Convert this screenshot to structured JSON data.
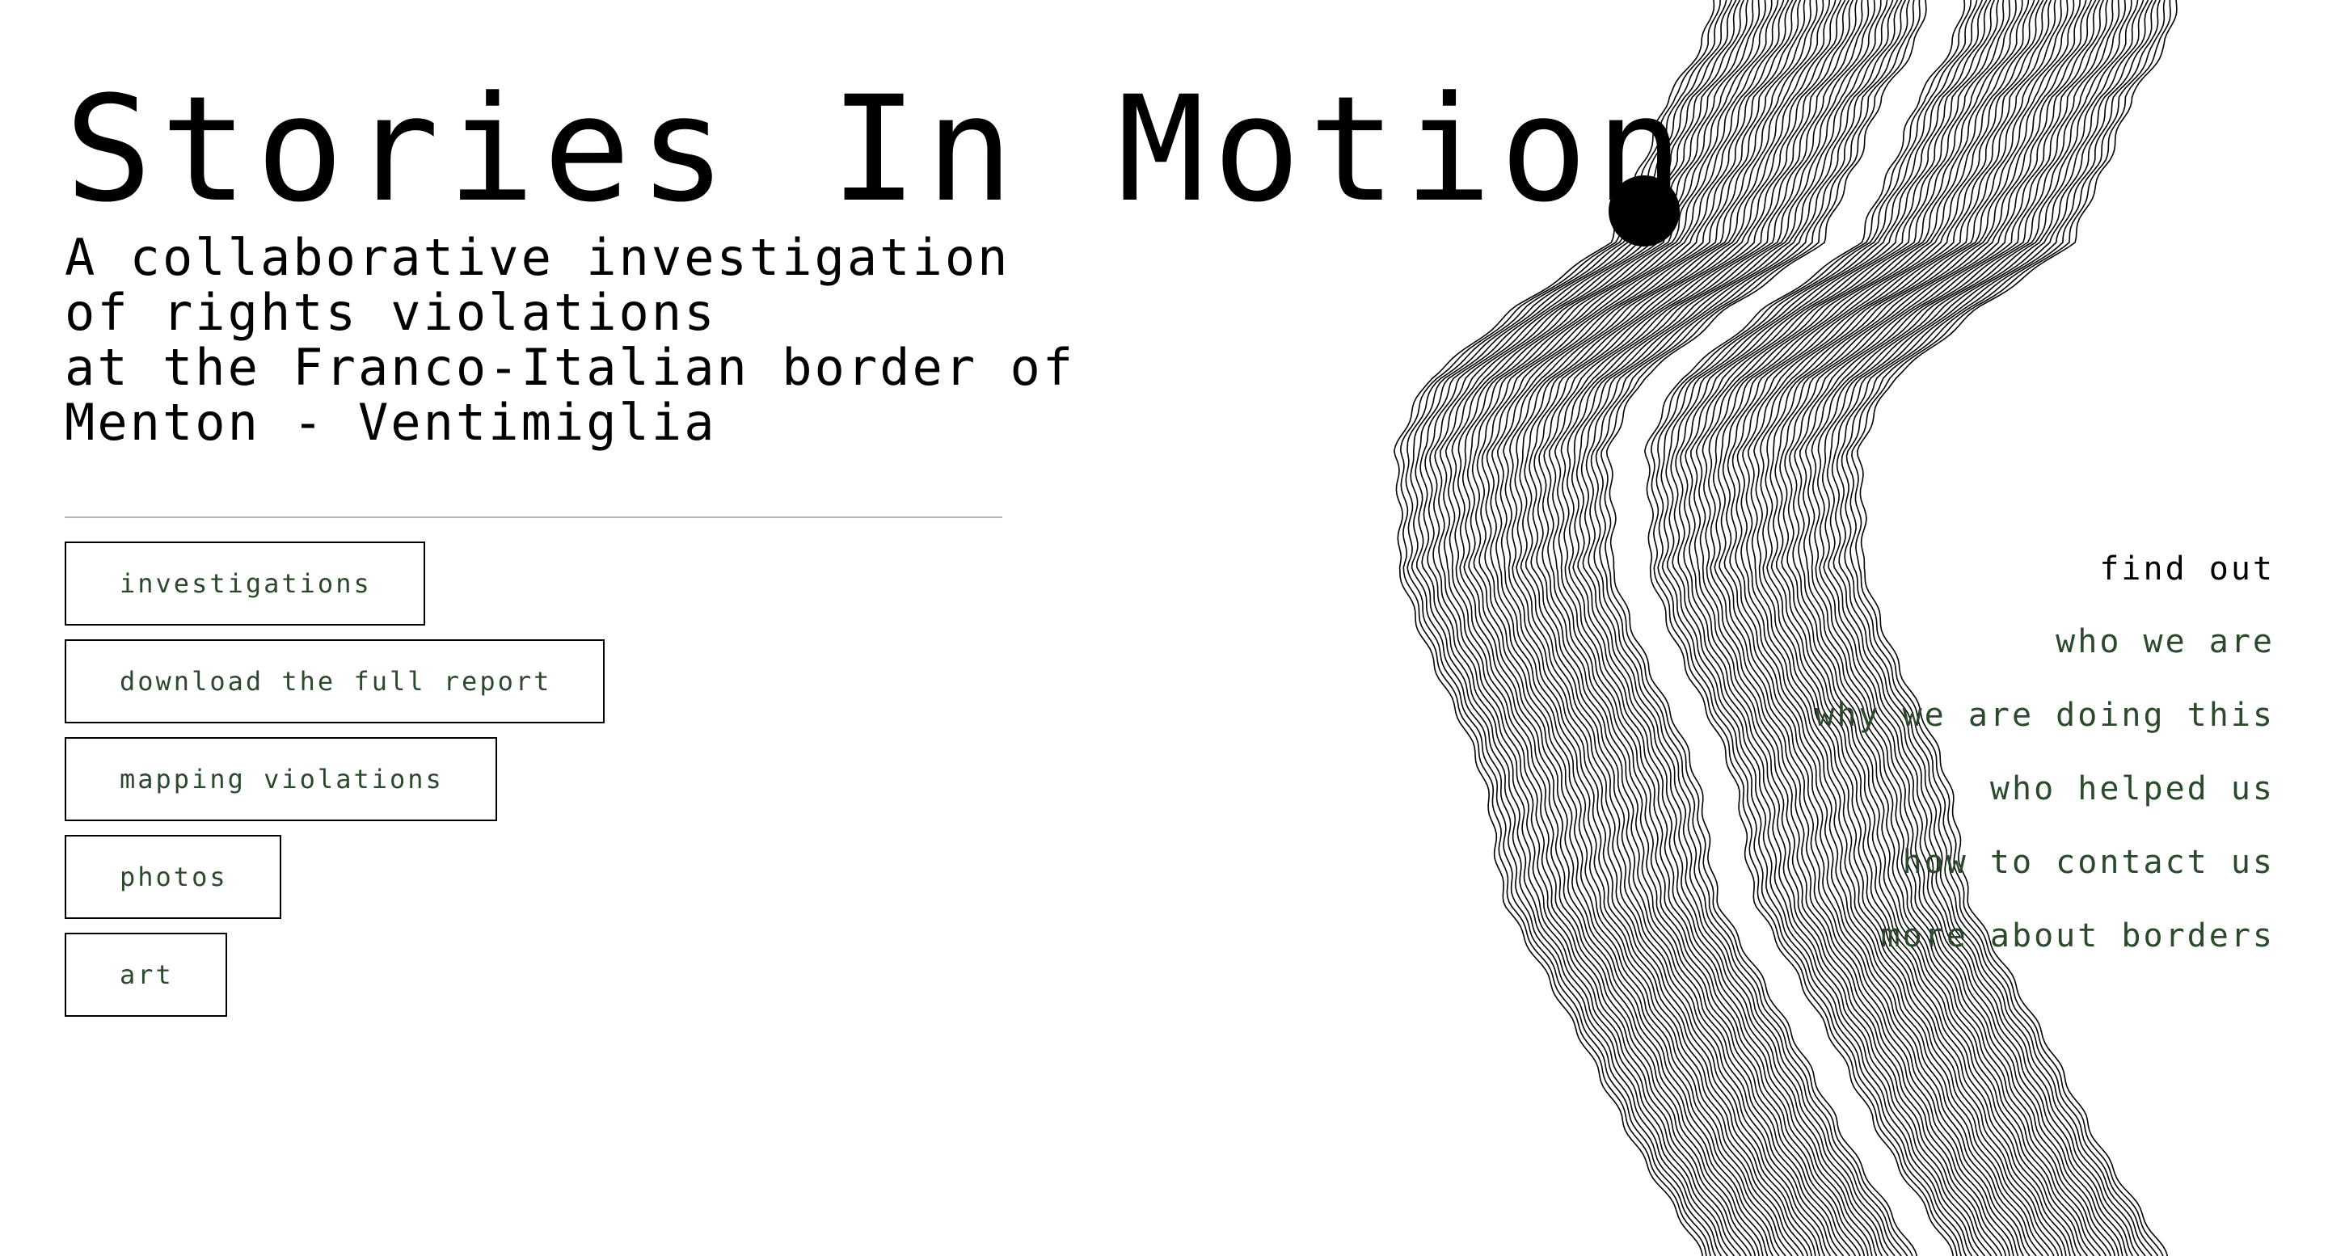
{
  "header": {
    "title": "Stories In Motion",
    "subtitle_lines": [
      "A collaborative investigation",
      "of rights violations",
      "at the Franco-Italian border of",
      "Menton - Ventimiglia"
    ]
  },
  "buttons": [
    {
      "label": "investigations"
    },
    {
      "label": "download the full report"
    },
    {
      "label": "mapping violations"
    },
    {
      "label": "photos"
    },
    {
      "label": "art"
    }
  ],
  "side_menu": {
    "heading": "find out",
    "links": [
      {
        "label": "who we are"
      },
      {
        "label": "why we are doing this"
      },
      {
        "label": "who helped us"
      },
      {
        "label": "how to contact us"
      },
      {
        "label": "more about borders"
      }
    ]
  },
  "colors": {
    "link_green": "#2b4a2b",
    "text": "#000000",
    "background": "#ffffff",
    "divider": "#b5b5b5"
  }
}
